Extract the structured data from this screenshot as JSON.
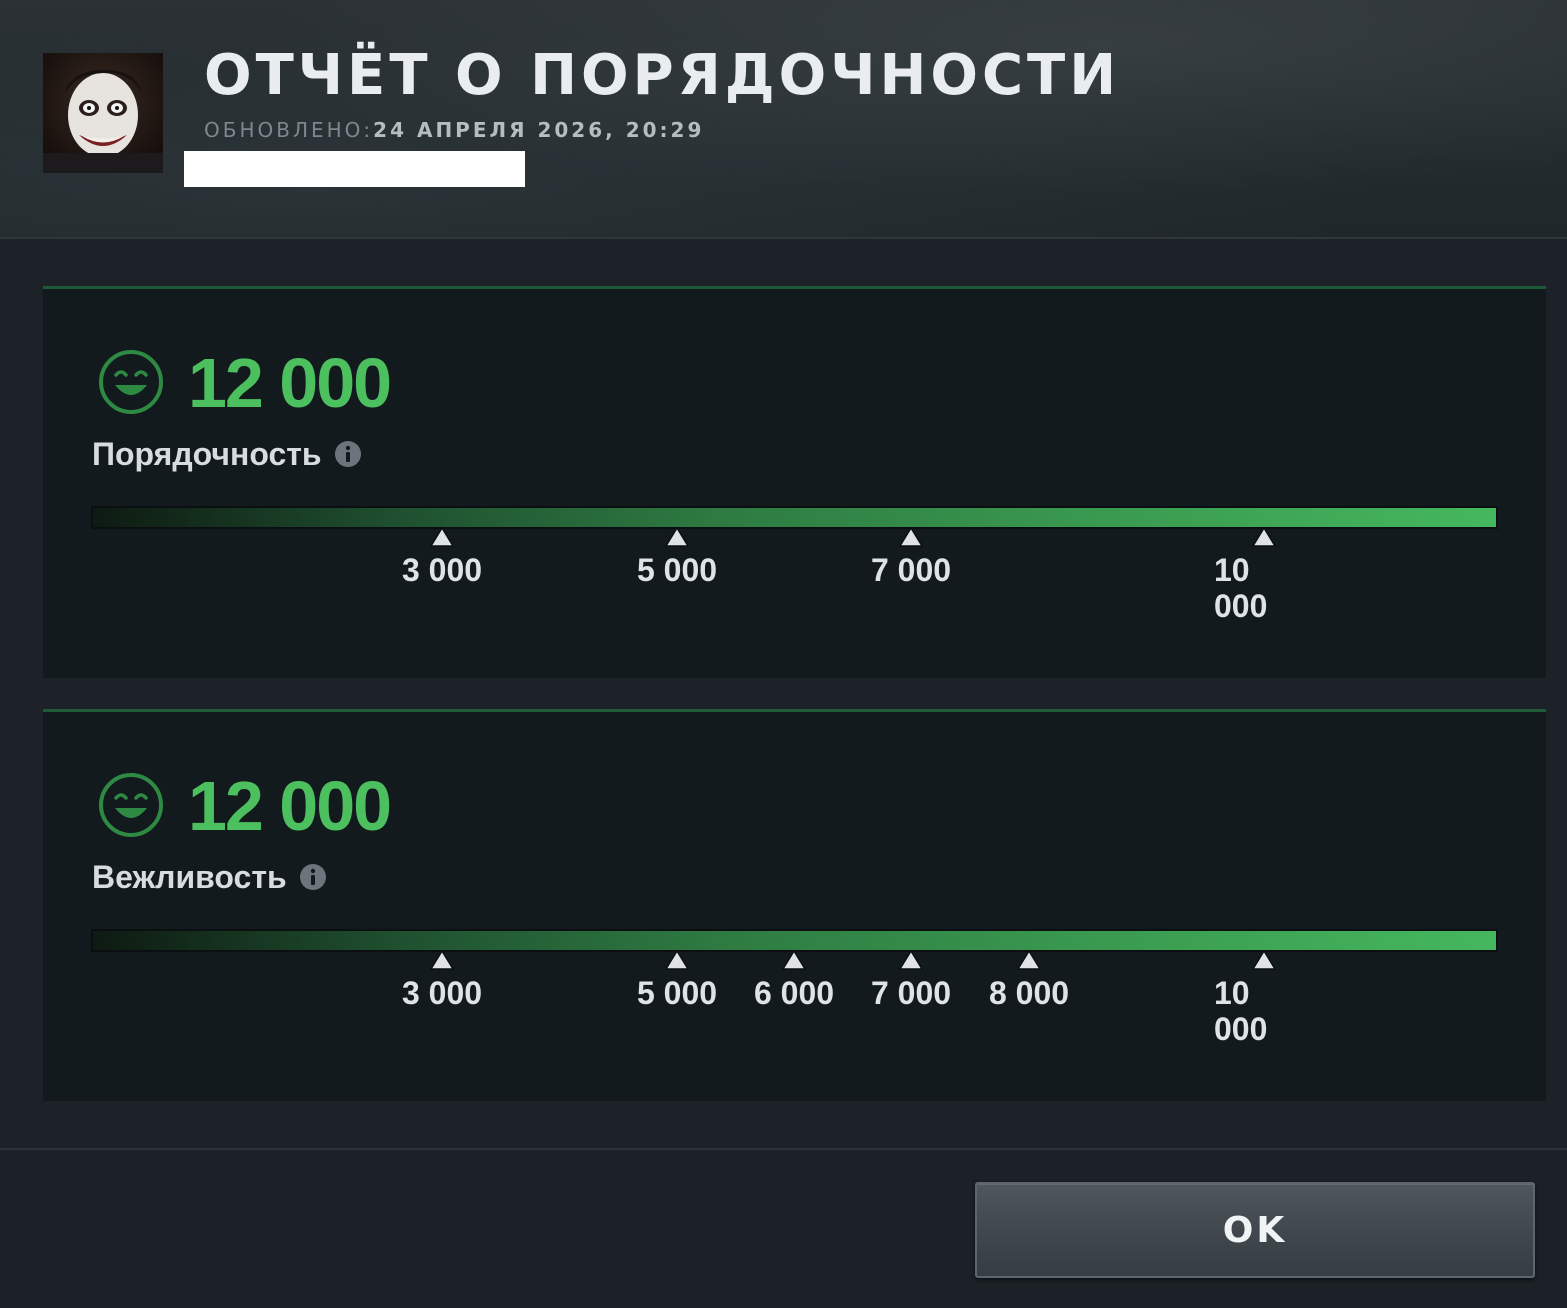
{
  "header": {
    "title": "ОТЧЁТ О ПОРЯДОЧНОСТИ",
    "updated_label": "ОБНОВЛЕНО:",
    "updated_value": "24 АПРЕЛЯ 2026, 20:29"
  },
  "panels": [
    {
      "score": "12 000",
      "label": "Порядочность",
      "icon": "smiley-icon",
      "markers": [
        {
          "value": 3000,
          "label": "3 000"
        },
        {
          "value": 5000,
          "label": "5 000"
        },
        {
          "value": 7000,
          "label": "7 000"
        },
        {
          "value": 10000,
          "label": "10 000"
        }
      ]
    },
    {
      "score": "12 000",
      "label": "Вежливость",
      "icon": "smiley-icon",
      "markers": [
        {
          "value": 3000,
          "label": "3 000"
        },
        {
          "value": 5000,
          "label": "5 000"
        },
        {
          "value": 6000,
          "label": "6 000"
        },
        {
          "value": 7000,
          "label": "7 000"
        },
        {
          "value": 8000,
          "label": "8 000"
        },
        {
          "value": 10000,
          "label": "10 000"
        }
      ]
    }
  ],
  "footer": {
    "ok_label": "OK"
  },
  "colors": {
    "accent_green": "#4cbf5e",
    "panel_bg": "#131a1e",
    "page_bg": "#1c2227"
  }
}
